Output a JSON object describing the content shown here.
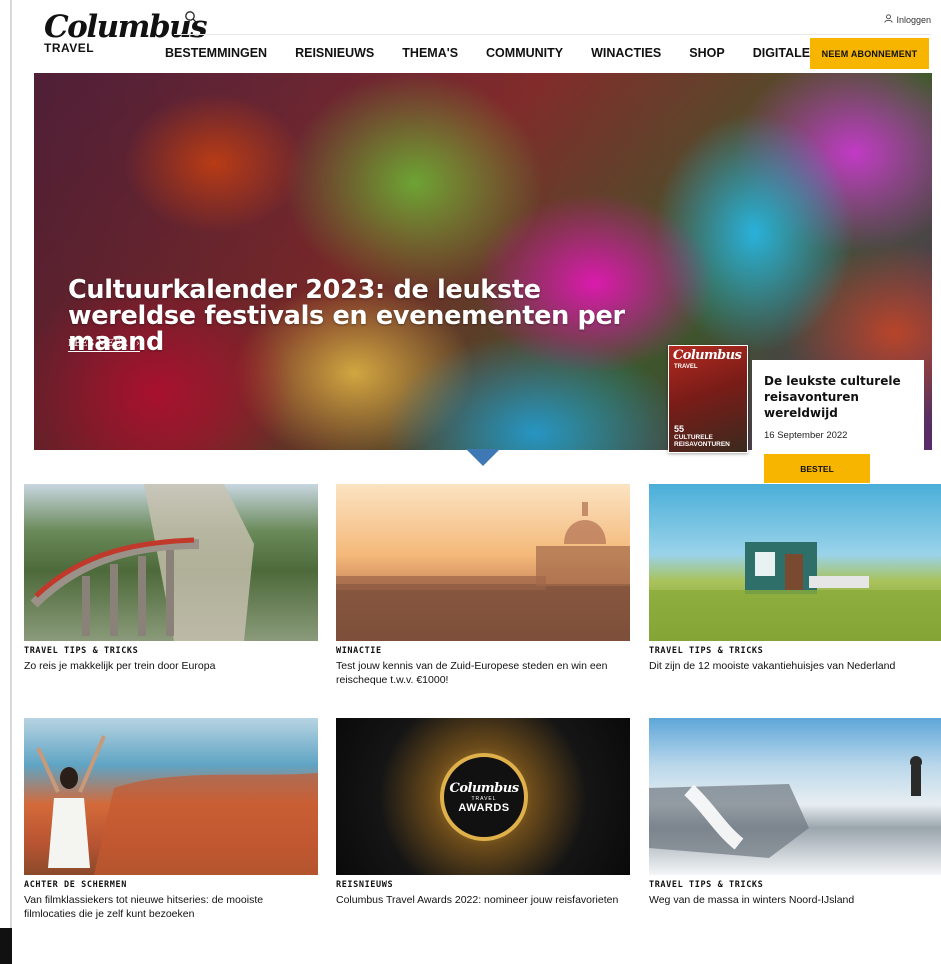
{
  "header": {
    "logo": "Columbus",
    "logo_sub": "TRAVEL",
    "login": "Inloggen",
    "nav": [
      "BESTEMMINGEN",
      "REISNIEUWS",
      "THEMA'S",
      "COMMUNITY",
      "WINACTIES",
      "SHOP",
      "DIGITALE EDITIES"
    ],
    "subscribe": "NEEM ABONNEMENT"
  },
  "hero": {
    "title": "Cultuurkalender 2023: de leukste wereldse festivals en evenementen per maand",
    "more": "LEES MEER"
  },
  "promo": {
    "cover_brand": "Columbus",
    "cover_travel": "TRAVEL",
    "cover_num": "55",
    "cover_text": "CULTURELE REISAVONTUREN",
    "title": "De leukste culturele reisavonturen wereldwijd",
    "date": "16 September 2022",
    "button": "BESTEL"
  },
  "cards": [
    {
      "category": "TRAVEL TIPS & TRICKS",
      "title": "Zo reis je makkelijk per trein door Europa"
    },
    {
      "category": "WINACTIE",
      "title": "Test jouw kennis van de Zuid-Europese steden en win een reischeque t.w.v. €1000!"
    },
    {
      "category": "TRAVEL TIPS & TRICKS",
      "title": "Dit zijn de 12 mooiste vakantiehuisjes van Nederland"
    },
    {
      "category": "ACHTER DE SCHERMEN",
      "title": "Van filmklassiekers tot nieuwe hitseries: de mooiste filmlocaties die je zelf kunt bezoeken"
    },
    {
      "category": "REISNIEUWS",
      "title": "Columbus Travel Awards 2022: nomineer jouw reisfavorieten"
    },
    {
      "category": "TRAVEL TIPS & TRICKS",
      "title": "Weg van de massa in winters Noord-IJsland"
    }
  ],
  "awards_badge": {
    "brand": "Columbus",
    "travel": "TRAVEL",
    "label": "AWARDS"
  },
  "colors": {
    "accent": "#f7b500",
    "notch": "#3f79b5"
  }
}
